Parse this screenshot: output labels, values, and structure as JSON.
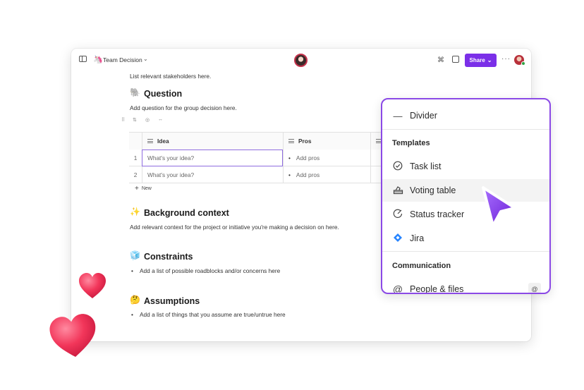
{
  "topbar": {
    "doc_title_emoji": "🦄",
    "doc_title": "Team Decision",
    "share_label": "Share",
    "share_chevron": "⌄",
    "title_chevron": "⌄",
    "more": "···"
  },
  "doc": {
    "intro_text": "List relevant stakeholders here.",
    "question": {
      "emoji": "🐘",
      "heading": "Question",
      "text": "Add question for the group decision here."
    },
    "table_tools": {
      "sort": "⇅",
      "hide": "◎",
      "resize": "↔"
    },
    "table": {
      "columns": [
        "Idea",
        "Pros"
      ],
      "rows": [
        {
          "num": "1",
          "idea": "What's your idea?",
          "pros": "Add pros"
        },
        {
          "num": "2",
          "idea": "What's your idea?",
          "pros": "Add pros"
        }
      ],
      "new_label": "New",
      "new_icon": "+",
      "bullet": "•"
    },
    "background": {
      "emoji": "✨",
      "heading": "Background context",
      "text": "Add relevant context for the project or initiative you're making a decision on here."
    },
    "constraints": {
      "emoji": "🧊",
      "heading": "Constraints",
      "bullet": "Add a list of possible roadblocks and/or concerns here"
    },
    "assumptions": {
      "emoji": "🤔",
      "heading": "Assumptions",
      "bullet": "Add a list of things that you assume are true/untrue here"
    }
  },
  "menu": {
    "divider_item": {
      "icon": "divider-icon",
      "label": "Divider"
    },
    "templates_title": "Templates",
    "templates": [
      {
        "icon": "check-circle-icon",
        "label": "Task list"
      },
      {
        "icon": "voting-box-icon",
        "label": "Voting table"
      },
      {
        "icon": "status-gauge-icon",
        "label": "Status tracker"
      },
      {
        "icon": "jira-icon",
        "label": "Jira"
      }
    ],
    "communication_title": "Communication",
    "communication": [
      {
        "icon": "at-sign-icon",
        "label": "People & files",
        "shortcut": "@"
      }
    ]
  },
  "colors": {
    "accent": "#7b2fe8",
    "menu_border": "#8b49e6",
    "heart": "#f2365a"
  }
}
